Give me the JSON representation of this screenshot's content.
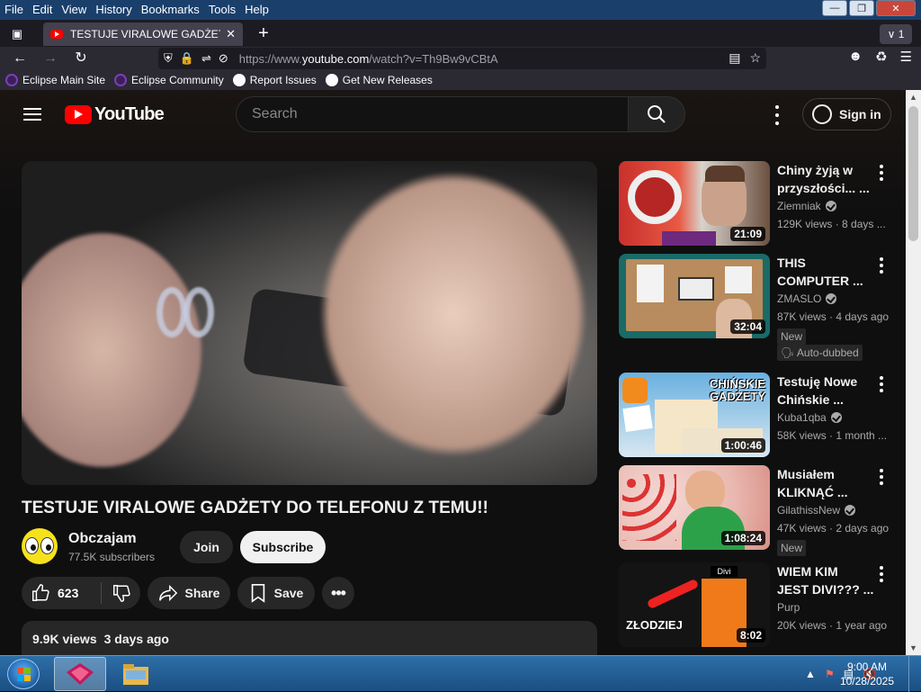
{
  "browser": {
    "menu": [
      "File",
      "Edit",
      "View",
      "History",
      "Bookmarks",
      "Tools",
      "Help"
    ],
    "tab_title": "TESTUJE VIRALOWE GADŻETY D",
    "tab_count": "1",
    "url_prefix": "https://www.",
    "url_domain": "youtube.com",
    "url_path": "/watch?v=Th9Bw9vCBtA",
    "bookmarks": [
      "Eclipse Main Site",
      "Eclipse Community",
      "Report Issues",
      "Get New Releases"
    ]
  },
  "youtube": {
    "logo_text": "YouTube",
    "search_placeholder": "Search",
    "sign_in": "Sign in"
  },
  "video": {
    "title": "TESTUJE VIRALOWE GADŻETY DO TELEFONU Z TEMU!!",
    "channel": "Obczajam",
    "subscribers": "77.5K subscribers",
    "join": "Join",
    "subscribe": "Subscribe",
    "likes": "623",
    "share": "Share",
    "save": "Save",
    "views": "9.9K views",
    "date": "3 days ago"
  },
  "related": [
    {
      "title1": "Chiny żyją w",
      "title2": "przyszłości... ...",
      "channel": "Ziemniak",
      "verified": true,
      "meta": "129K views · 8 days ...",
      "duration": "21:09",
      "badges": []
    },
    {
      "title1": "THIS",
      "title2": "COMPUTER ...",
      "channel": "ZMASLO",
      "verified": true,
      "meta": "87K views · 4 days ago",
      "duration": "32:04",
      "badges": [
        "New",
        "Auto-dubbed"
      ]
    },
    {
      "title1": "Testuję Nowe",
      "title2": "Chińskie ...",
      "channel": "Kuba1qba",
      "verified": true,
      "meta": "58K views · 1 month ...",
      "duration": "1:00:46",
      "badges": []
    },
    {
      "title1": "Musiałem",
      "title2": "KLIKNĄĆ ...",
      "channel": "GilathissNew",
      "verified": true,
      "meta": "47K views · 2 days ago",
      "duration": "1:08:24",
      "badges": [
        "New"
      ]
    },
    {
      "title1": "WIEM KIM",
      "title2": "JEST DIVI??? ...",
      "channel": "Purp",
      "verified": false,
      "meta": "20K views · 1 year ago",
      "duration": "8:02",
      "badges": []
    }
  ],
  "thumb_text": {
    "t3_main": "CHIŃSKIE GADŻETY",
    "t5_label": "Divi",
    "t5_main": "ZŁODZIEJ"
  },
  "taskbar": {
    "time": "9:00 AM",
    "date": "10/28/2025"
  }
}
